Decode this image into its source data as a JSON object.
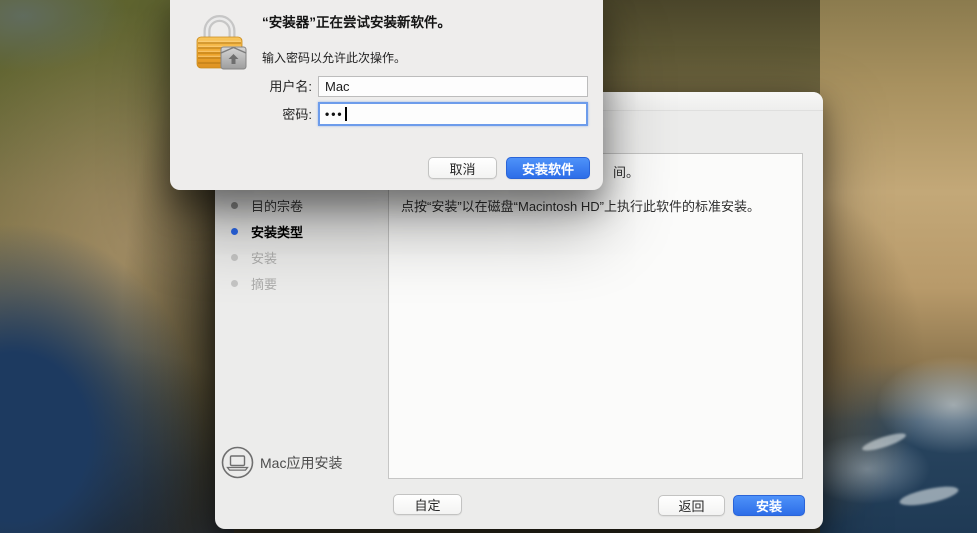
{
  "auth_dialog": {
    "title": "“安装器”正在尝试安装新软件。",
    "subtitle": "输入密码以允许此次操作。",
    "fields": {
      "username_label": "用户名:",
      "username_value": "Mac",
      "password_label": "密码:",
      "password_value": "•••"
    },
    "buttons": {
      "cancel": "取消",
      "install_software": "安装软件"
    }
  },
  "installer": {
    "sidebar": {
      "steps": [
        {
          "label": "目的宗卷",
          "state": "completed"
        },
        {
          "label": "安装类型",
          "state": "current"
        },
        {
          "label": "安装",
          "state": "pending"
        },
        {
          "label": "摘要",
          "state": "pending"
        }
      ]
    },
    "content": {
      "clipped_line_tail": "间。",
      "instruction": "点按“安装”以在磁盘“Macintosh HD”上执行此软件的标准安装。"
    },
    "footer": {
      "app_name": "Mac应用安装",
      "customize": "自定",
      "go_back": "返回",
      "install": "安装"
    }
  },
  "colors": {
    "accent_blue": "#2E7BF6",
    "focus_ring": "#6D9CEB",
    "lock_gold": "#EFA62C",
    "window_bg": "#ECECEB"
  }
}
